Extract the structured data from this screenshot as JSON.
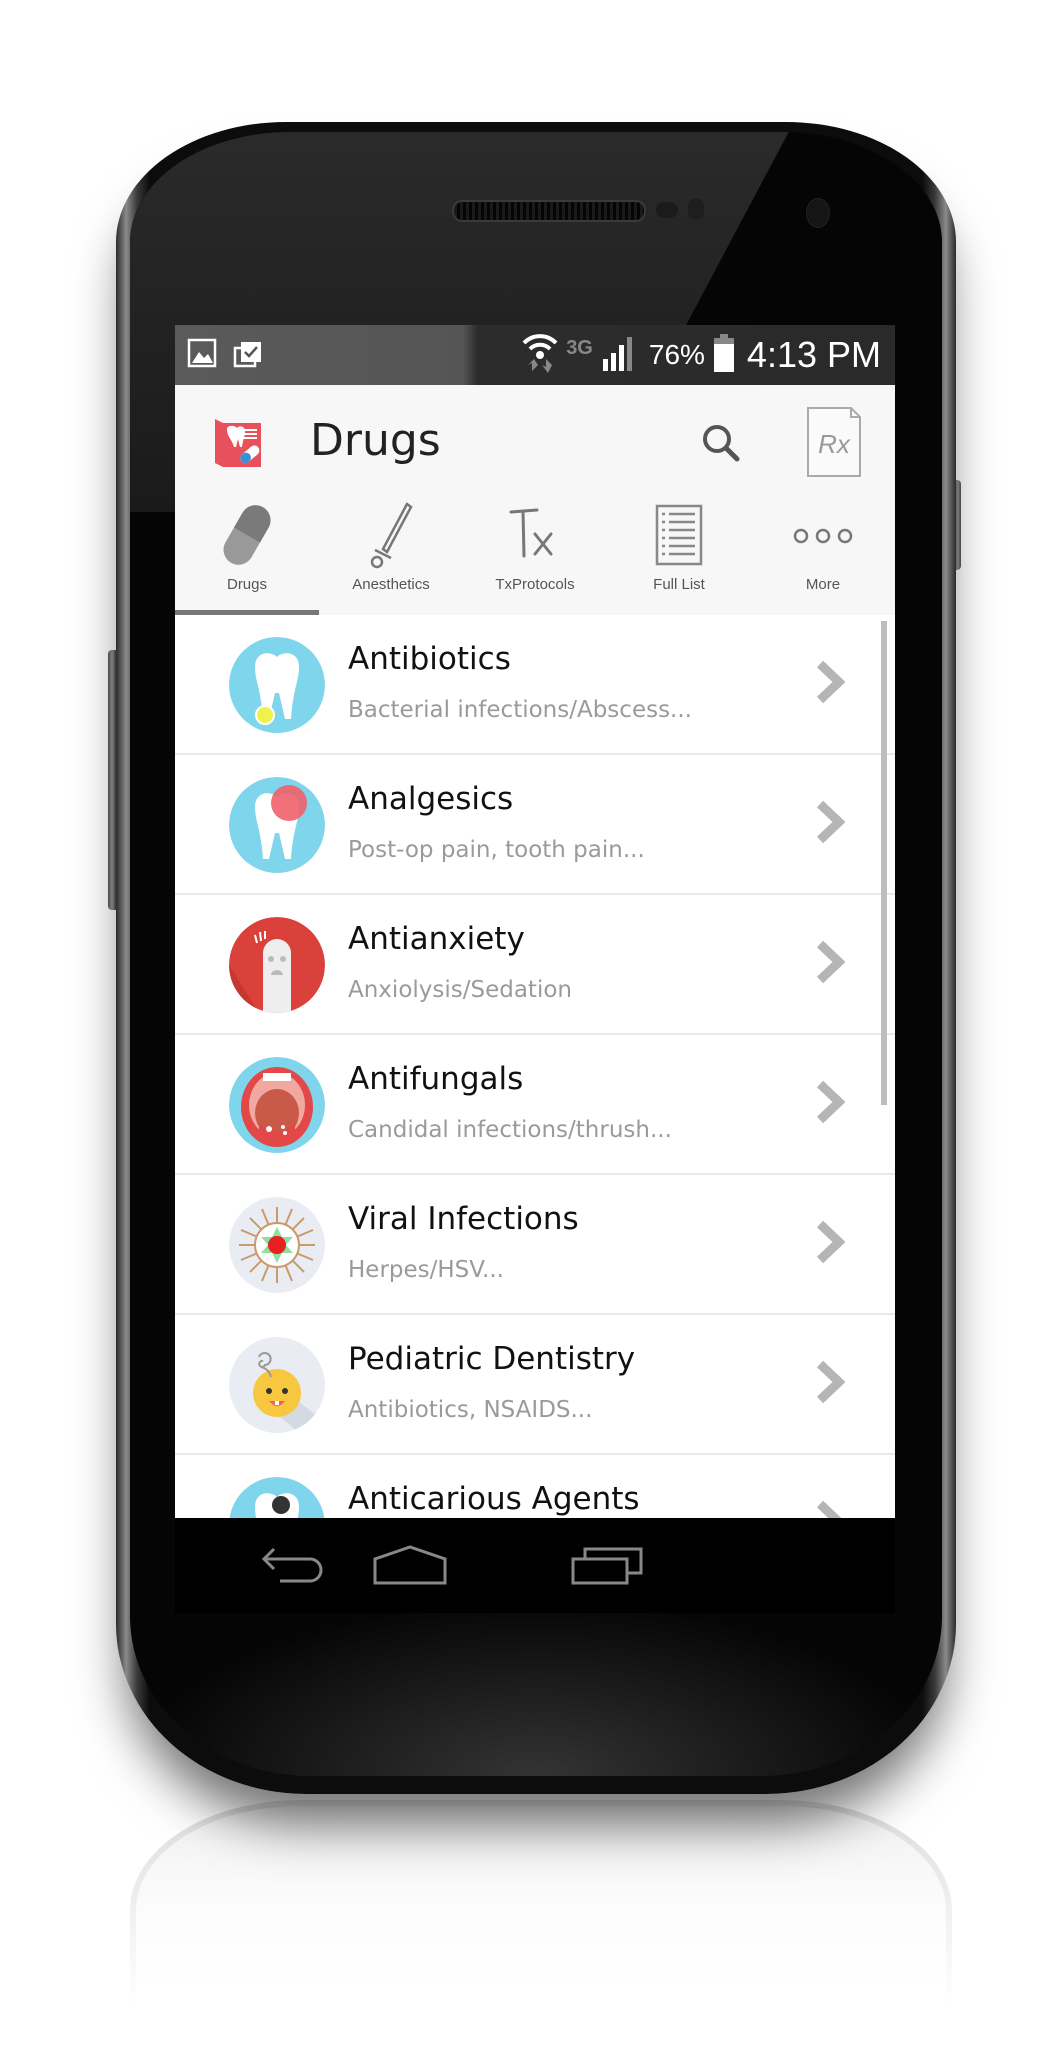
{
  "status_bar": {
    "left_icons": [
      "gallery-icon",
      "clipboard-check-icon"
    ],
    "network_type": "3G",
    "battery_percent": "76%",
    "time": "4:13 PM"
  },
  "app_bar": {
    "title": "Drugs",
    "logo_icon": "dental-rx-logo-icon",
    "actions": [
      "search-icon",
      "rx-prescription-icon"
    ]
  },
  "tabs": [
    {
      "label": "Drugs",
      "icon": "pill-icon",
      "selected": true
    },
    {
      "label": "Anesthetics",
      "icon": "syringe-icon",
      "selected": false
    },
    {
      "label": "TxProtocols",
      "icon": "tx-icon",
      "selected": false
    },
    {
      "label": "Full List",
      "icon": "list-icon",
      "selected": false
    },
    {
      "label": "More",
      "icon": "more-dots-icon",
      "selected": false
    }
  ],
  "categories": [
    {
      "title": "Antibiotics",
      "subtitle": "Bacterial infections/Abscess...",
      "icon": "tooth-abscess-icon"
    },
    {
      "title": "Analgesics",
      "subtitle": "Post-op pain, tooth pain...",
      "icon": "tooth-pain-icon"
    },
    {
      "title": "Antianxiety",
      "subtitle": "Anxiolysis/Sedation",
      "icon": "anxious-tooth-icon"
    },
    {
      "title": "Antifungals",
      "subtitle": "Candidal infections/thrush...",
      "icon": "open-mouth-icon"
    },
    {
      "title": "Viral Infections",
      "subtitle": "Herpes/HSV...",
      "icon": "virus-icon"
    },
    {
      "title": "Pediatric Dentistry",
      "subtitle": "Antibiotics, NSAIDS...",
      "icon": "baby-icon"
    },
    {
      "title": "Anticarious Agents",
      "subtitle": "",
      "icon": "tooth-cavity-icon"
    }
  ],
  "nav_bar": [
    "back-icon",
    "home-icon",
    "recent-apps-icon"
  ],
  "colors": {
    "brand_red": "#e8505b",
    "light_blue": "#7fd6ec",
    "anxiety_red": "#d9413a",
    "chevron_gray": "#b5b5b5",
    "tab_indicator": "#777777"
  }
}
